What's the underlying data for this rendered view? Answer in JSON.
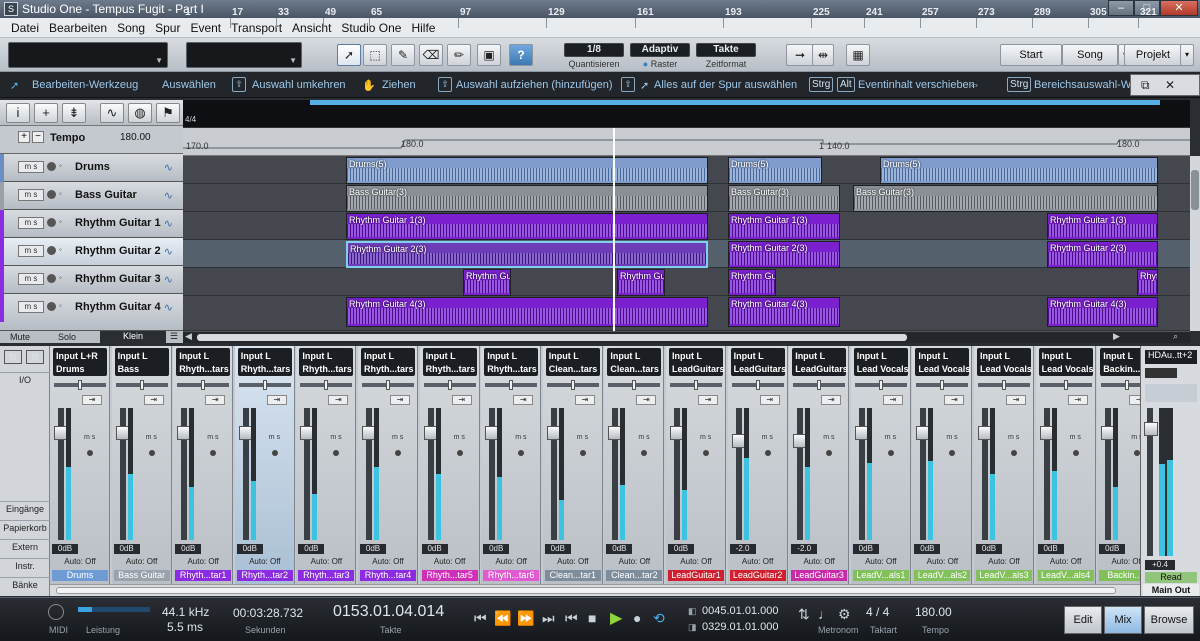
{
  "window": {
    "title": "Studio One - Tempus Fugit - Part I"
  },
  "menu": [
    "Datei",
    "Bearbeiten",
    "Song",
    "Spur",
    "Event",
    "Transport",
    "Ansicht",
    "Studio One",
    "Hilfe"
  ],
  "toolbar": {
    "quantize": {
      "value": "1/8",
      "label": "Quantisieren"
    },
    "snap": {
      "value": "Adaptiv",
      "label": "Raster"
    },
    "timeformat": {
      "value": "Takte",
      "label": "Zeitformat"
    },
    "pages": [
      "Start",
      "Song",
      "Projekt"
    ]
  },
  "infobar": {
    "tool": "Bearbeiten-Werkzeug",
    "select": "Auswählen",
    "invert": "Auswahl umkehren",
    "drag": "Ziehen",
    "expand": "Auswahl aufziehen (hinzufügen)",
    "select_all_track": "Alles auf der Spur auswählen",
    "key_strg": "Strg",
    "key_alt": "Alt",
    "move_content": "Eventinhalt verschieben",
    "range_select": "Bereichsauswahl-Wer"
  },
  "ruler": {
    "signature": "4/4",
    "bars": [
      "1",
      "17",
      "33",
      "49",
      "65",
      "97",
      "129",
      "161",
      "193",
      "225",
      "241",
      "257",
      "273",
      "289",
      "305",
      "321"
    ]
  },
  "tempo": {
    "label": "Tempo",
    "value": "180.00",
    "points": [
      "170.0",
      "180.0",
      "140.0",
      "180.0"
    ],
    "marker": "1"
  },
  "tracks": [
    {
      "name": "Drums",
      "color": "#6c8cc4"
    },
    {
      "name": "Bass Guitar",
      "color": "#9aa0a6"
    },
    {
      "name": "Rhythm Guitar 1",
      "color": "#8b2be2"
    },
    {
      "name": "Rhythm Guitar 2",
      "color": "#8b2be2"
    },
    {
      "name": "Rhythm Guitar 3",
      "color": "#8b2be2"
    },
    {
      "name": "Rhythm Guitar 4",
      "color": "#8b2be2"
    }
  ],
  "clips": {
    "drums": [
      "Drums(5)",
      "Drums(5)",
      "Drums(5)"
    ],
    "bass": [
      "Bass Guitar(3)",
      "Bass Guitar(3)",
      "Bass Guitar(3)"
    ],
    "rg1": [
      "Rhythm Guitar 1(3)",
      "Rhythm Guitar 1(3)",
      "Rhythm Guitar 1(3)"
    ],
    "rg2": [
      "Rhythm Guitar 2(3)",
      "Rhythm Guitar 2(3)",
      "Rhythm Guitar 2(3)"
    ],
    "rg3": [
      "Rhythm Guit",
      "Rhythm Guit",
      "Rhythm Gu",
      "Rhyt"
    ],
    "rg4": [
      "Rhythm Guitar 4(3)",
      "Rhythm Guitar 4(3)",
      "Rhythm Guitar 4(3)"
    ]
  },
  "left_footer": {
    "mute": "Mute",
    "solo": "Solo",
    "size": "Klein"
  },
  "mixer_left": {
    "io": "I/O",
    "inputs": "Eingänge",
    "bin": "Papierkorb",
    "external": "Extern",
    "instr": "Instr.",
    "banks": "Bänke"
  },
  "channels": [
    {
      "input": "Input L+R",
      "short": "Drums",
      "name": "Drums",
      "vol": "0dB",
      "auto": "Auto: Off",
      "color": "#6e9bd4",
      "meter": 55,
      "fader": 0.85
    },
    {
      "input": "Input L",
      "short": "Bass",
      "name": "Bass Guitar",
      "vol": "0dB",
      "auto": "Auto: Off",
      "color": "#9aa2ab",
      "meter": 50,
      "fader": 0.85
    },
    {
      "input": "Input L",
      "short": "Rhyth...tars",
      "name": "Rhyth...tar1",
      "vol": "0dB",
      "auto": "Auto: Off",
      "color": "#8b2be2",
      "meter": 40,
      "fader": 0.85
    },
    {
      "input": "Input L",
      "short": "Rhyth...tars",
      "name": "Rhyth...tar2",
      "vol": "0dB",
      "auto": "Auto: Off",
      "color": "#8b2be2",
      "meter": 45,
      "fader": 0.85
    },
    {
      "input": "Input L",
      "short": "Rhyth...tars",
      "name": "Rhyth...tar3",
      "vol": "0dB",
      "auto": "Auto: Off",
      "color": "#8b2be2",
      "meter": 35,
      "fader": 0.85
    },
    {
      "input": "Input L",
      "short": "Rhyth...tars",
      "name": "Rhyth...tar4",
      "vol": "0dB",
      "auto": "Auto: Off",
      "color": "#8b2be2",
      "meter": 55,
      "fader": 0.85
    },
    {
      "input": "Input L",
      "short": "Rhyth...tars",
      "name": "Rhyth...tar5",
      "vol": "0dB",
      "auto": "Auto: Off",
      "color": "#d02fb8",
      "meter": 50,
      "fader": 0.85
    },
    {
      "input": "Input L",
      "short": "Rhyth...tars",
      "name": "Rhyth...tar6",
      "vol": "0dB",
      "auto": "Auto: Off",
      "color": "#e25ad2",
      "meter": 48,
      "fader": 0.85
    },
    {
      "input": "Input L",
      "short": "Clean...tars",
      "name": "Clean...tar1",
      "vol": "0dB",
      "auto": "Auto: Off",
      "color": "#7e8d9c",
      "meter": 30,
      "fader": 0.85
    },
    {
      "input": "Input L",
      "short": "Clean...tars",
      "name": "Clean...tar2",
      "vol": "0dB",
      "auto": "Auto: Off",
      "color": "#7e8d9c",
      "meter": 42,
      "fader": 0.85
    },
    {
      "input": "Input L",
      "short": "LeadGuitars",
      "name": "LeadGuitar1",
      "vol": "0dB",
      "auto": "Auto: Off",
      "color": "#d01f2e",
      "meter": 38,
      "fader": 0.85
    },
    {
      "input": "Input L",
      "short": "LeadGuitars",
      "name": "LeadGuitar2",
      "vol": "-2.0",
      "auto": "Auto: Off",
      "color": "#d01f2e",
      "meter": 62,
      "fader": 0.78
    },
    {
      "input": "Input L",
      "short": "LeadGuitars",
      "name": "LeadGuitar3",
      "vol": "-2.0",
      "auto": "Auto: Off",
      "color": "#c82aa8",
      "meter": 55,
      "fader": 0.78
    },
    {
      "input": "Input L",
      "short": "Lead Vocals",
      "name": "LeadV...als1",
      "vol": "0dB",
      "auto": "Auto: Off",
      "color": "#82c05a",
      "meter": 58,
      "fader": 0.85
    },
    {
      "input": "Input L",
      "short": "Lead Vocals",
      "name": "LeadV...als2",
      "vol": "0dB",
      "auto": "Auto: Off",
      "color": "#82c05a",
      "meter": 60,
      "fader": 0.85
    },
    {
      "input": "Input L",
      "short": "Lead Vocals",
      "name": "LeadV...als3",
      "vol": "0dB",
      "auto": "Auto: Off",
      "color": "#82c05a",
      "meter": 50,
      "fader": 0.85
    },
    {
      "input": "Input L",
      "short": "Lead Vocals",
      "name": "LeadV...als4",
      "vol": "0dB",
      "auto": "Auto: Off",
      "color": "#82c05a",
      "meter": 52,
      "fader": 0.85
    },
    {
      "input": "Input L",
      "short": "Backin...als",
      "name": "Backin...a",
      "vol": "0dB",
      "auto": "Auto: Off",
      "color": "#82c05a",
      "meter": 40,
      "fader": 0.85
    }
  ],
  "mainout": {
    "top": "HDAu..tt+2",
    "vol": "+0.4",
    "read": "Read",
    "name": "Main Out"
  },
  "transport": {
    "midi": "MIDI",
    "perf": "Leistung",
    "sr": "44.1 kHz",
    "latency": "5.5 ms",
    "seconds": "00:03:28.732",
    "seconds_label": "Sekunden",
    "bars": "0153.01.04.014",
    "bars_label": "Takte",
    "loop_start": "0045.01.01.000",
    "loop_end": "0329.01.01.000",
    "metronome": "Metronom",
    "sig": "4 / 4",
    "sig_label": "Taktart",
    "tempo": "180.00",
    "tempo_label": "Tempo",
    "views": [
      "Edit",
      "Mix",
      "Browse"
    ]
  }
}
